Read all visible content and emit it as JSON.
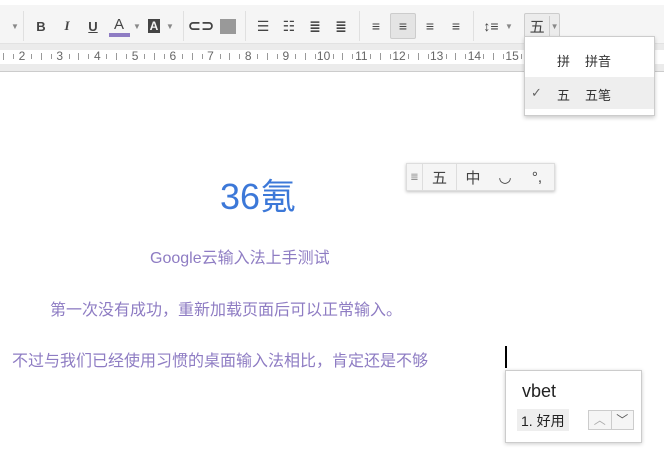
{
  "toolbar": {
    "bold": "B",
    "italic": "I",
    "underline": "U",
    "text_color": "A",
    "highlight": "A",
    "text_color_value": "#8e7cc3",
    "input_tool_label": "五",
    "icons": [
      "dropdown-arrow",
      "bold",
      "italic",
      "underline",
      "text-color",
      "highlight-color",
      "link",
      "image",
      "numbered-list",
      "bulleted-list",
      "decrease-indent",
      "increase-indent",
      "align-left",
      "align-center",
      "align-right",
      "justify",
      "line-spacing",
      "input-tools"
    ]
  },
  "ruler": {
    "numbers": [
      "2",
      "3",
      "4",
      "5",
      "6",
      "7",
      "8",
      "9",
      "10",
      "11",
      "12",
      "13",
      "14",
      "15"
    ]
  },
  "input_menu": {
    "items": [
      {
        "glyph": "拼",
        "label": "拼音",
        "checked": false
      },
      {
        "glyph": "五",
        "label": "五笔",
        "checked": true
      }
    ],
    "check": "✓"
  },
  "document": {
    "title": "36氪",
    "subtitle": "Google云输入法上手测试",
    "paragraph1": "第一次没有成功，重新加载页面后可以正常输入。",
    "paragraph2": "不过与我们已经使用习惯的桌面输入法相比，肯定还是不够",
    "title_color": "#3c78d8",
    "text_color": "#8e7cc3"
  },
  "ime_toolbar": {
    "mode": "五",
    "lang": "中",
    "width_icon": "half-moon",
    "punct": "°,"
  },
  "candidates": {
    "composition": "vbet",
    "items": [
      "1. 好用"
    ]
  }
}
